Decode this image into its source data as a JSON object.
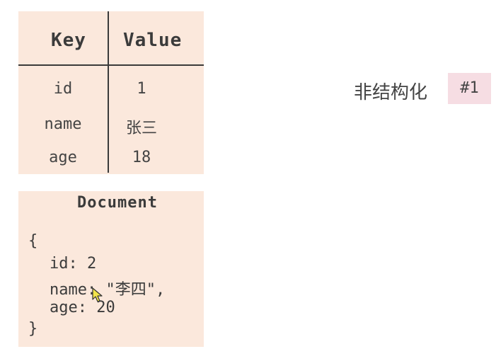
{
  "table": {
    "header": {
      "key": "Key",
      "value": "Value"
    },
    "rows": [
      {
        "key": "id",
        "value": "1"
      },
      {
        "key": "name",
        "value": "张三"
      },
      {
        "key": "age",
        "value": "18"
      }
    ]
  },
  "document": {
    "title": "Document",
    "lines": [
      "{",
      "id: 2",
      "name: \"李四\",",
      "age: 20",
      "}"
    ]
  },
  "label": {
    "text": "非结构化",
    "badge": "#1"
  },
  "colors": {
    "card_bg": "#fbe8dc",
    "badge_bg": "#f6dde3",
    "divider": "#3a3a3a",
    "text": "#3b3b3b"
  }
}
